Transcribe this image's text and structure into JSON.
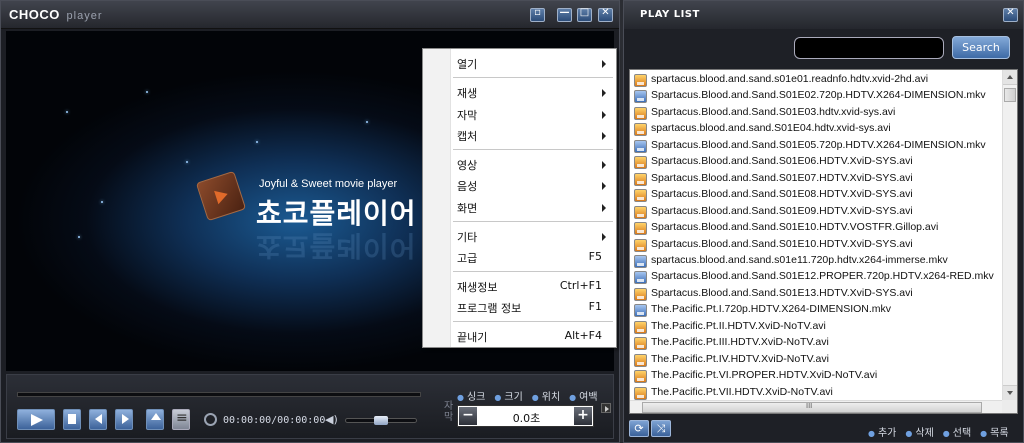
{
  "app": {
    "logo_main": "CHOCO",
    "logo_sub": "player",
    "window_buttons": {
      "mini": "▫",
      "minimize": "—",
      "maximize": "□",
      "close": "✕"
    }
  },
  "video": {
    "tagline": "Joyful & Sweet movie player",
    "title_ko": "쵸코플레이어"
  },
  "context_menu": {
    "items": [
      {
        "label": "열기",
        "submenu": true
      },
      {
        "label": "재생",
        "submenu": true
      },
      {
        "label": "자막",
        "submenu": true
      },
      {
        "label": "캡처",
        "submenu": true
      },
      {
        "label": "영상",
        "submenu": true
      },
      {
        "label": "음성",
        "submenu": true
      },
      {
        "label": "화면",
        "submenu": true
      },
      {
        "label": "기타",
        "submenu": true
      },
      {
        "label": "고급",
        "shortcut": "F5"
      },
      {
        "label": "재생정보",
        "shortcut": "Ctrl+F1"
      },
      {
        "label": "프로그램 정보",
        "shortcut": "F1"
      },
      {
        "label": "끝내기",
        "shortcut": "Alt+F4"
      }
    ]
  },
  "controls": {
    "time": "00:00:00/00:00:00",
    "volume_level": 0.5,
    "sync_options": [
      "싱크",
      "크기",
      "위치",
      "여백"
    ],
    "sync_label": "자막",
    "sync_value": "0.0초",
    "minus": "−",
    "plus": "+"
  },
  "playlist": {
    "title": "PLAY LIST",
    "close": "✕",
    "search_button": "Search",
    "search_value": "",
    "files": [
      {
        "name": "spartacus.blood.and.sand.s01e01.readnfo.hdtv.xvid-2hd.avi",
        "type": "avi"
      },
      {
        "name": "Spartacus.Blood.and.Sand.S01E02.720p.HDTV.X264-DIMENSION.mkv",
        "type": "mkv"
      },
      {
        "name": "Spartacus.Blood.and.Sand.S01E03.hdtv.xvid-sys.avi",
        "type": "avi"
      },
      {
        "name": "spartacus.blood.and.sand.S01E04.hdtv.xvid-sys.avi",
        "type": "avi"
      },
      {
        "name": "Spartacus.Blood.and.Sand.S01E05.720p.HDTV.X264-DIMENSION.mkv",
        "type": "mkv"
      },
      {
        "name": "Spartacus.Blood.and.Sand.S01E06.HDTV.XviD-SYS.avi",
        "type": "avi"
      },
      {
        "name": "Spartacus.Blood.and.Sand.S01E07.HDTV.XviD-SYS.avi",
        "type": "avi"
      },
      {
        "name": "Spartacus.Blood.and.Sand.S01E08.HDTV.XviD-SYS.avi",
        "type": "avi"
      },
      {
        "name": "Spartacus.Blood.and.Sand.S01E09.HDTV.XviD-SYS.avi",
        "type": "avi"
      },
      {
        "name": "Spartacus.Blood.and.Sand.S01E10.HDTV.VOSTFR.Gillop.avi",
        "type": "avi"
      },
      {
        "name": "Spartacus.Blood.and.Sand.S01E10.HDTV.XviD-SYS.avi",
        "type": "avi"
      },
      {
        "name": "spartacus.blood.and.sand.s01e11.720p.hdtv.x264-immerse.mkv",
        "type": "mkv"
      },
      {
        "name": "Spartacus.Blood.and.Sand.S01E12.PROPER.720p.HDTV.x264-RED.mkv",
        "type": "mkv"
      },
      {
        "name": "Spartacus.Blood.and.Sand.S01E13.HDTV.XviD-SYS.avi",
        "type": "avi"
      },
      {
        "name": "The.Pacific.Pt.I.720p.HDTV.X264-DIMENSION.mkv",
        "type": "mkv"
      },
      {
        "name": "The.Pacific.Pt.II.HDTV.XviD-NoTV.avi",
        "type": "avi"
      },
      {
        "name": "The.Pacific.Pt.III.HDTV.XviD-NoTV.avi",
        "type": "avi"
      },
      {
        "name": "The.Pacific.Pt.IV.HDTV.XviD-NoTV.avi",
        "type": "avi"
      },
      {
        "name": "The.Pacific.Pt.VI.PROPER.HDTV.XviD-NoTV.avi",
        "type": "avi"
      },
      {
        "name": "The.Pacific.Pt.VII.HDTV.XviD-NoTV.avi",
        "type": "avi"
      }
    ],
    "actions": [
      "추가",
      "삭제",
      "선택",
      "목록"
    ],
    "hscroll_grip": "III"
  }
}
